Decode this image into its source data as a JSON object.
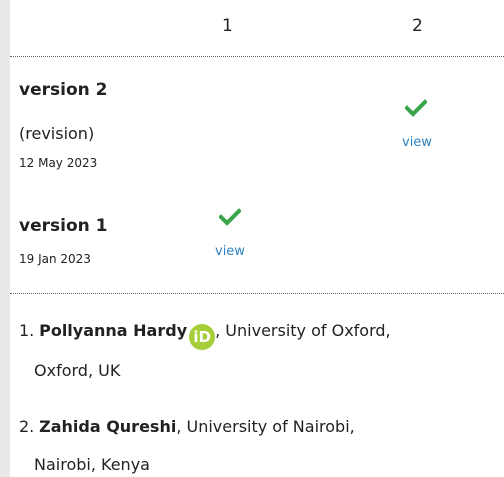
{
  "columns": [
    "1",
    "2"
  ],
  "versions": [
    {
      "title": "version 2",
      "note": "(revision)",
      "date": "12 May 2023",
      "link": "view"
    },
    {
      "title": "version 1",
      "date": "19 Jan 2023",
      "link": "view"
    }
  ],
  "authors": [
    {
      "num": "1.",
      "name": "Pollyanna Hardy",
      "orcid": "iD",
      "affil_line1": ", University of Oxford,",
      "affil_line2": "Oxford, UK"
    },
    {
      "num": "2.",
      "name": "Zahida Qureshi",
      "affil_line1": ", University of Nairobi,",
      "affil_line2": "Nairobi, Kenya"
    }
  ],
  "colors": {
    "accent": "#2f82bf",
    "check": "#3aa54a",
    "orcid": "#a6ce39"
  }
}
